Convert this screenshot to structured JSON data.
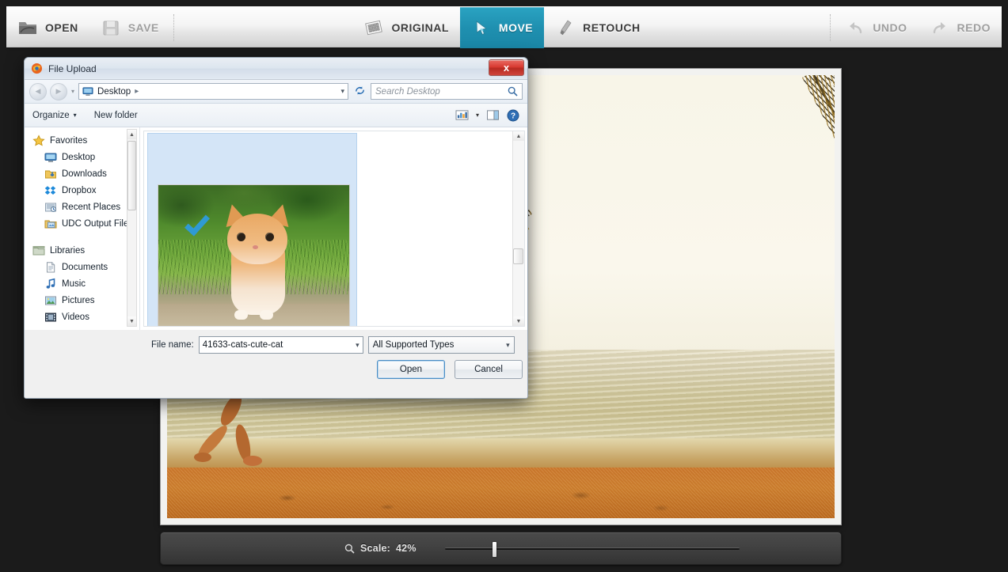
{
  "app": {
    "toolbar": {
      "open_label": "OPEN",
      "save_label": "SAVE",
      "original_label": "ORIGINAL",
      "move_label": "MOVE",
      "retouch_label": "RETOUCH",
      "undo_label": "UNDO",
      "redo_label": "REDO",
      "active_tab": "MOVE",
      "accent_color": "#1f90b0"
    },
    "statusbar": {
      "scale_label": "Scale:",
      "scale_value": "42%",
      "slider_position_percent": 16
    }
  },
  "dialog": {
    "title": "File Upload",
    "close_label": "x",
    "nav": {
      "back_glyph": "◀",
      "forward_glyph": "▶",
      "dropdown_glyph": "▾",
      "breadcrumb": "Desktop",
      "breadcrumb_arrow": "▸",
      "address_dropdown": "▾",
      "refresh_glyph": "↻",
      "search_placeholder": "Search Desktop",
      "search_value": ""
    },
    "commandbar": {
      "organize_label": "Organize",
      "organize_caret": "▾",
      "new_folder_label": "New folder",
      "view_caret": "▾",
      "help_glyph": "?"
    },
    "navigation_pane": {
      "groups": [
        {
          "label": "Favorites",
          "icon": "star-icon",
          "items": [
            {
              "label": "Desktop",
              "icon": "desktop-icon"
            },
            {
              "label": "Downloads",
              "icon": "downloads-icon"
            },
            {
              "label": "Dropbox",
              "icon": "dropbox-icon"
            },
            {
              "label": "Recent Places",
              "icon": "recent-places-icon"
            },
            {
              "label": "UDC Output Files",
              "icon": "udc-output-icon"
            }
          ]
        },
        {
          "label": "Libraries",
          "icon": "libraries-icon",
          "items": [
            {
              "label": "Documents",
              "icon": "documents-icon"
            },
            {
              "label": "Music",
              "icon": "music-icon"
            },
            {
              "label": "Pictures",
              "icon": "pictures-icon"
            },
            {
              "label": "Videos",
              "icon": "videos-icon"
            }
          ]
        }
      ]
    },
    "file_list": {
      "selected_file": "41633-cats-cute-cat",
      "items": [
        {
          "name": "41633-cats-cute-cat",
          "selected": true,
          "thumbnail": "kitten-photo-thumbnail"
        }
      ]
    },
    "footer": {
      "filename_label": "File name:",
      "filename_value": "41633-cats-cute-cat",
      "filename_dropdown": "▾",
      "filter_value": "All Supported Types",
      "filter_dropdown": "▾",
      "open_button": "Open",
      "cancel_button": "Cancel"
    }
  }
}
